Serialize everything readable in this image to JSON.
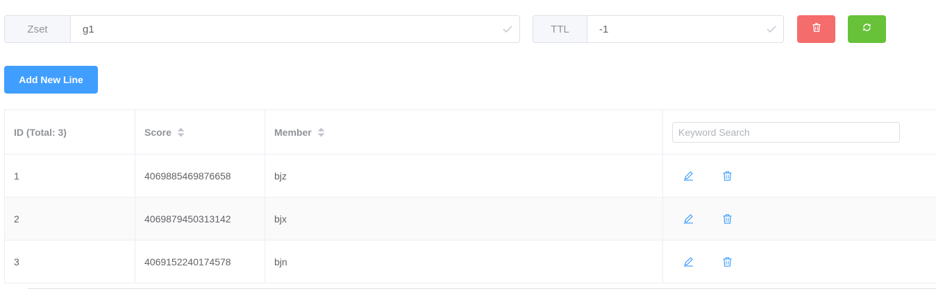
{
  "key_group": {
    "type_label": "Zset",
    "key_value": "g1"
  },
  "ttl_group": {
    "label": "TTL",
    "value": "-1"
  },
  "actions": {
    "add_line_label": "Add New Line"
  },
  "colors": {
    "danger": "#f56c6c",
    "success": "#67c23a",
    "primary": "#409eff"
  },
  "table": {
    "headers": {
      "id": "ID (Total: 3)",
      "score": "Score",
      "member": "Member"
    },
    "search_placeholder": "Keyword Search",
    "rows": [
      {
        "id": "1",
        "score": "4069885469876658",
        "member": "bjz"
      },
      {
        "id": "2",
        "score": "4069879450313142",
        "member": "bjx"
      },
      {
        "id": "3",
        "score": "4069152240174578",
        "member": "bjn"
      }
    ]
  }
}
